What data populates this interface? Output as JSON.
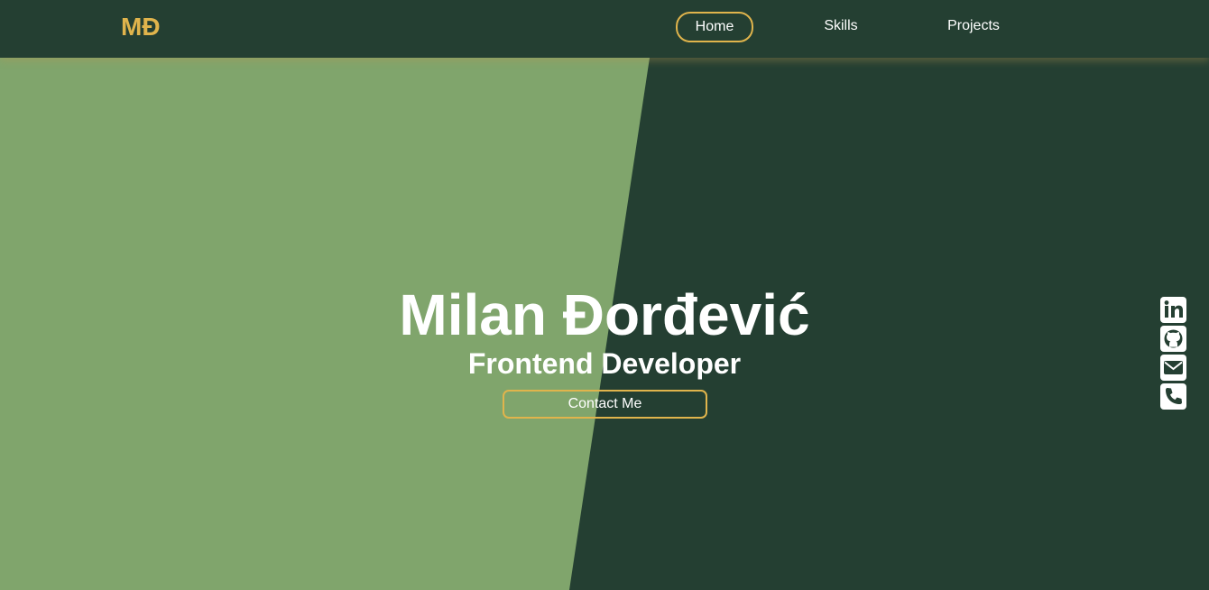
{
  "nav": {
    "logo": "MĐ",
    "links": [
      {
        "label": "Home",
        "active": true
      },
      {
        "label": "Skills",
        "active": false
      },
      {
        "label": "Projects",
        "active": false
      }
    ]
  },
  "hero": {
    "name": "Milan Đorđević",
    "role": "Frontend Developer",
    "cta_label": "Contact Me"
  },
  "social": [
    "linkedin-icon",
    "github-icon",
    "mail-icon",
    "phone-icon"
  ],
  "colors": {
    "dark_green": "#243f32",
    "light_green": "#80a56c",
    "accent": "#e0b44c",
    "text": "#ffffff"
  }
}
